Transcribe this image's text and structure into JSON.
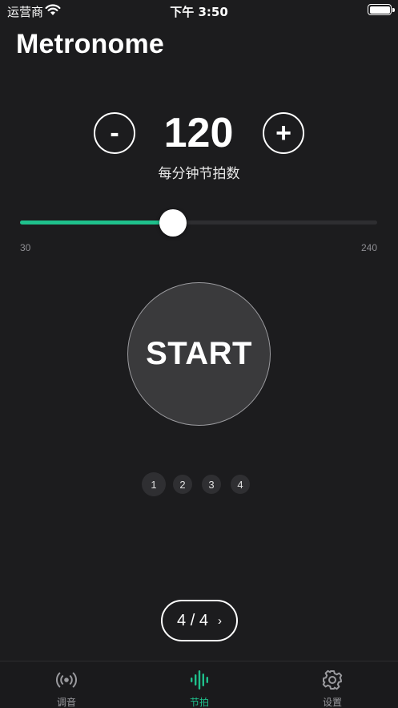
{
  "status_bar": {
    "carrier": "运营商",
    "time": "下午 3:50"
  },
  "page_title": "Metronome",
  "bpm": {
    "value": "120",
    "label": "每分钟节拍数",
    "minus_label": "-",
    "plus_label": "+"
  },
  "slider": {
    "min": "30",
    "max": "240",
    "value": 120,
    "min_value": 30,
    "max_value": 240,
    "fill_color": "#1fc08c"
  },
  "start_label": "START",
  "beats": [
    {
      "label": "1",
      "active": true
    },
    {
      "label": "2",
      "active": false
    },
    {
      "label": "3",
      "active": false
    },
    {
      "label": "4",
      "active": false
    }
  ],
  "time_signature": {
    "value": "4 / 4",
    "chevron": "›"
  },
  "tabs": [
    {
      "label": "调音",
      "icon": "radio-waves-icon",
      "active": false
    },
    {
      "label": "节拍",
      "icon": "waveform-icon",
      "active": true
    },
    {
      "label": "设置",
      "icon": "gear-icon",
      "active": false
    }
  ],
  "colors": {
    "accent": "#1fc08c",
    "background": "#1c1c1e",
    "inactive": "#9a9a9e"
  }
}
